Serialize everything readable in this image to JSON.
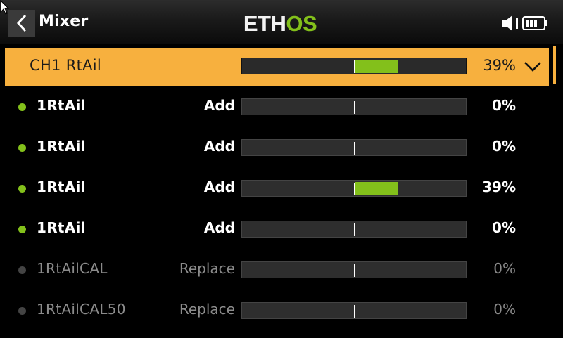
{
  "header": {
    "title": "Mixer",
    "logo_text": "ETHOS"
  },
  "colors": {
    "accent": "#f7b03e",
    "bar_fill": "#83c01b",
    "dot_active": "#83c01b"
  },
  "channel": {
    "label": "CH1 RtAil",
    "value": "39%",
    "fill_percent": 39
  },
  "mixes": [
    {
      "name": "1RtAil",
      "mode": "Add",
      "value": "0%",
      "fill_percent": 0,
      "active": true
    },
    {
      "name": "1RtAil",
      "mode": "Add",
      "value": "0%",
      "fill_percent": 0,
      "active": true
    },
    {
      "name": "1RtAil",
      "mode": "Add",
      "value": "39%",
      "fill_percent": 39,
      "active": true
    },
    {
      "name": "1RtAil",
      "mode": "Add",
      "value": "0%",
      "fill_percent": 0,
      "active": true
    },
    {
      "name": "1RtAilCAL",
      "mode": "Replace",
      "value": "0%",
      "fill_percent": 0,
      "active": false
    },
    {
      "name": "1RtAilCAL50",
      "mode": "Replace",
      "value": "0%",
      "fill_percent": 0,
      "active": false
    }
  ]
}
